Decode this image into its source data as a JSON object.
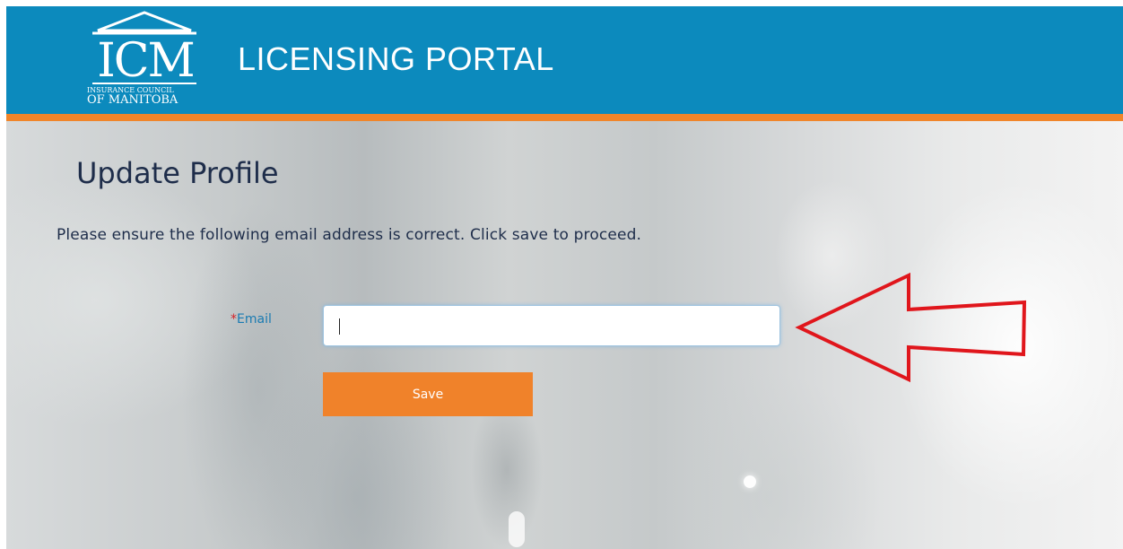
{
  "header": {
    "logo": {
      "letters": "ICM",
      "line1": "INSURANCE COUNCIL",
      "line2": "OF MANITOBA"
    },
    "portal_title": "LICENSING PORTAL",
    "colors": {
      "header_bg": "#0c8abd",
      "stripe": "#f0852a"
    }
  },
  "main": {
    "page_title": "Update Profile",
    "instructions": "Please ensure the following email address is correct. Click save to proceed.",
    "form": {
      "email": {
        "required_marker": "*",
        "label": "Email",
        "value": "",
        "placeholder": ""
      },
      "save_label": "Save"
    },
    "annotation": {
      "icon": "red-arrow-left",
      "color": "#e0161c"
    },
    "colors": {
      "title_text": "#1e2d4a",
      "label_text": "#1a7bb2",
      "button_bg": "#f0822a"
    }
  }
}
